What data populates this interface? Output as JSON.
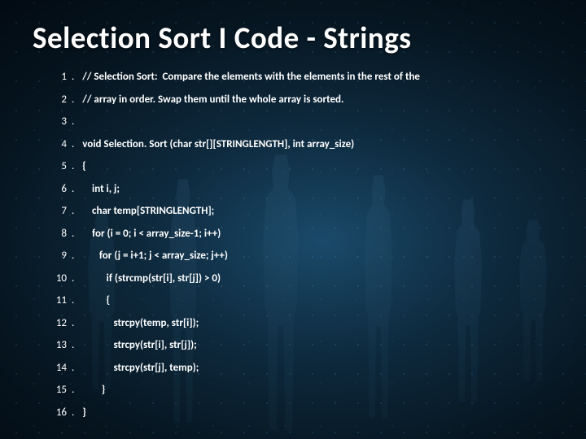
{
  "title": "Selection Sort I Code - Strings",
  "lines": [
    {
      "n": "1",
      "text": "// Selection Sort:  Compare the elements with the elements in the rest of the"
    },
    {
      "n": "2",
      "text": "// array in order. Swap them until the whole array is sorted."
    },
    {
      "n": "3",
      "text": ""
    },
    {
      "n": "4",
      "text": "void Selection. Sort (char str[][STRINGLENGTH], int array_size)"
    },
    {
      "n": "5",
      "text": "{"
    },
    {
      "n": "6",
      "text": "    int i, j;"
    },
    {
      "n": "7",
      "text": "    char temp[STRINGLENGTH];"
    },
    {
      "n": "8",
      "text": "    for (i = 0; i < array_size-1; i++)"
    },
    {
      "n": "9",
      "text": "       for (j = i+1; j < array_size; j++)"
    },
    {
      "n": "10",
      "text": "          if (strcmp(str[i], str[j]) > 0)"
    },
    {
      "n": "11",
      "text": "          {"
    },
    {
      "n": "12",
      "text": "             strcpy(temp, str[i]);"
    },
    {
      "n": "13",
      "text": "             strcpy(str[i], str[j]);"
    },
    {
      "n": "14",
      "text": "             strcpy(str[j], temp);"
    },
    {
      "n": "15",
      "text": "        }"
    },
    {
      "n": "16",
      "text": "}"
    }
  ]
}
